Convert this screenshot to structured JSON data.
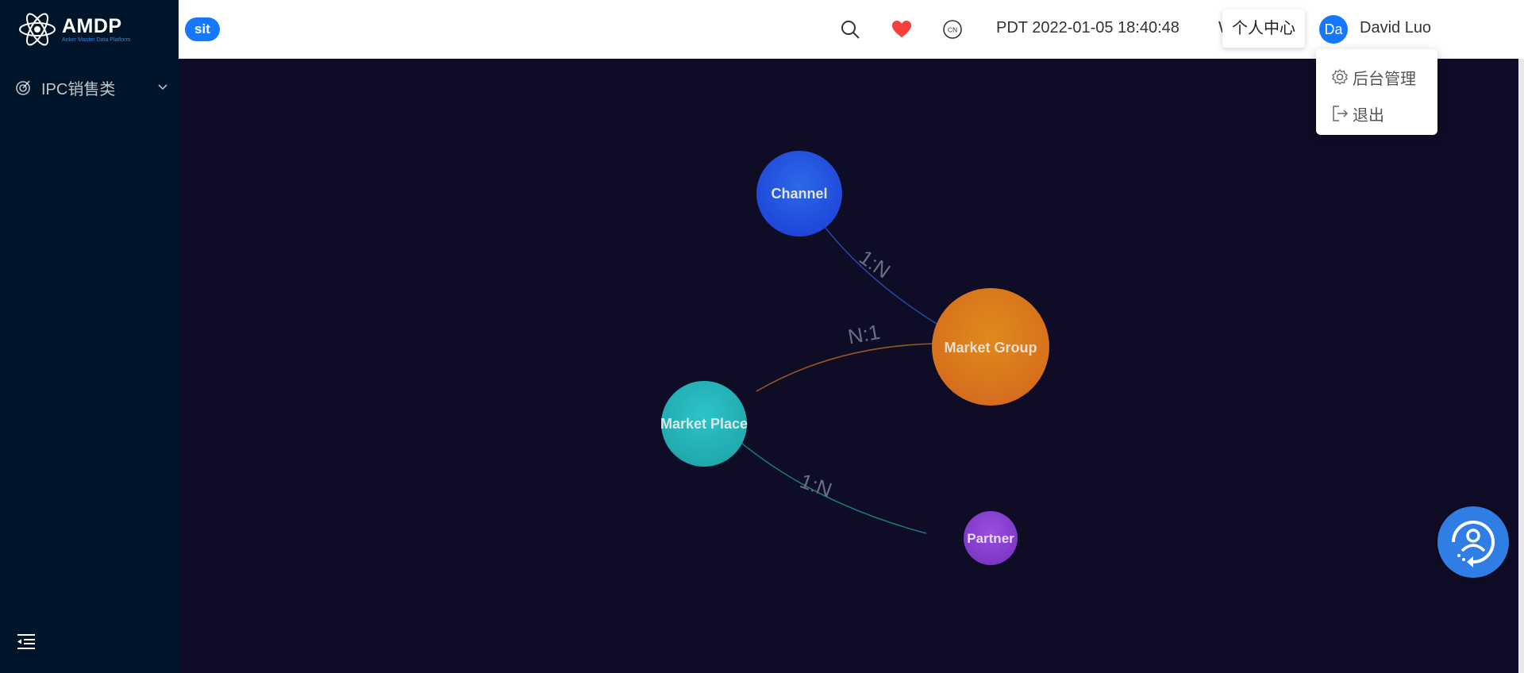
{
  "brand": {
    "title": "AMDP",
    "subtitle": "Anker Master Data Platform"
  },
  "sidebar": {
    "items": [
      {
        "label": "IPC销售类",
        "icon": "target-icon"
      }
    ]
  },
  "header": {
    "env_badge": "sit",
    "icons": [
      "search-icon",
      "heart-icon",
      "language-cn-icon"
    ],
    "lang": "CN",
    "time": "PDT 2022-01-05 18:40:48",
    "tooltip": "个人中心",
    "avatar_text": "Da",
    "username": "David Luo"
  },
  "dropdown": {
    "items": [
      {
        "label": "后台管理",
        "icon": "settings-icon"
      },
      {
        "label": "退出",
        "icon": "logout-icon"
      }
    ]
  },
  "graph": {
    "nodes": [
      {
        "label": "Channel",
        "color": "#1f45d8"
      },
      {
        "label": "Market Group",
        "color": "#d97a1a"
      },
      {
        "label": "Market Place",
        "color": "#23b2b8"
      },
      {
        "label": "Partner",
        "color": "#8a3fd0"
      }
    ],
    "edges": [
      {
        "source": "Channel",
        "target": "Market Group",
        "label": "1:N"
      },
      {
        "source": "Market Place",
        "target": "Market Group",
        "label": "N:1"
      },
      {
        "source": "Market Place",
        "target": "Partner",
        "label": "1:N"
      }
    ]
  }
}
